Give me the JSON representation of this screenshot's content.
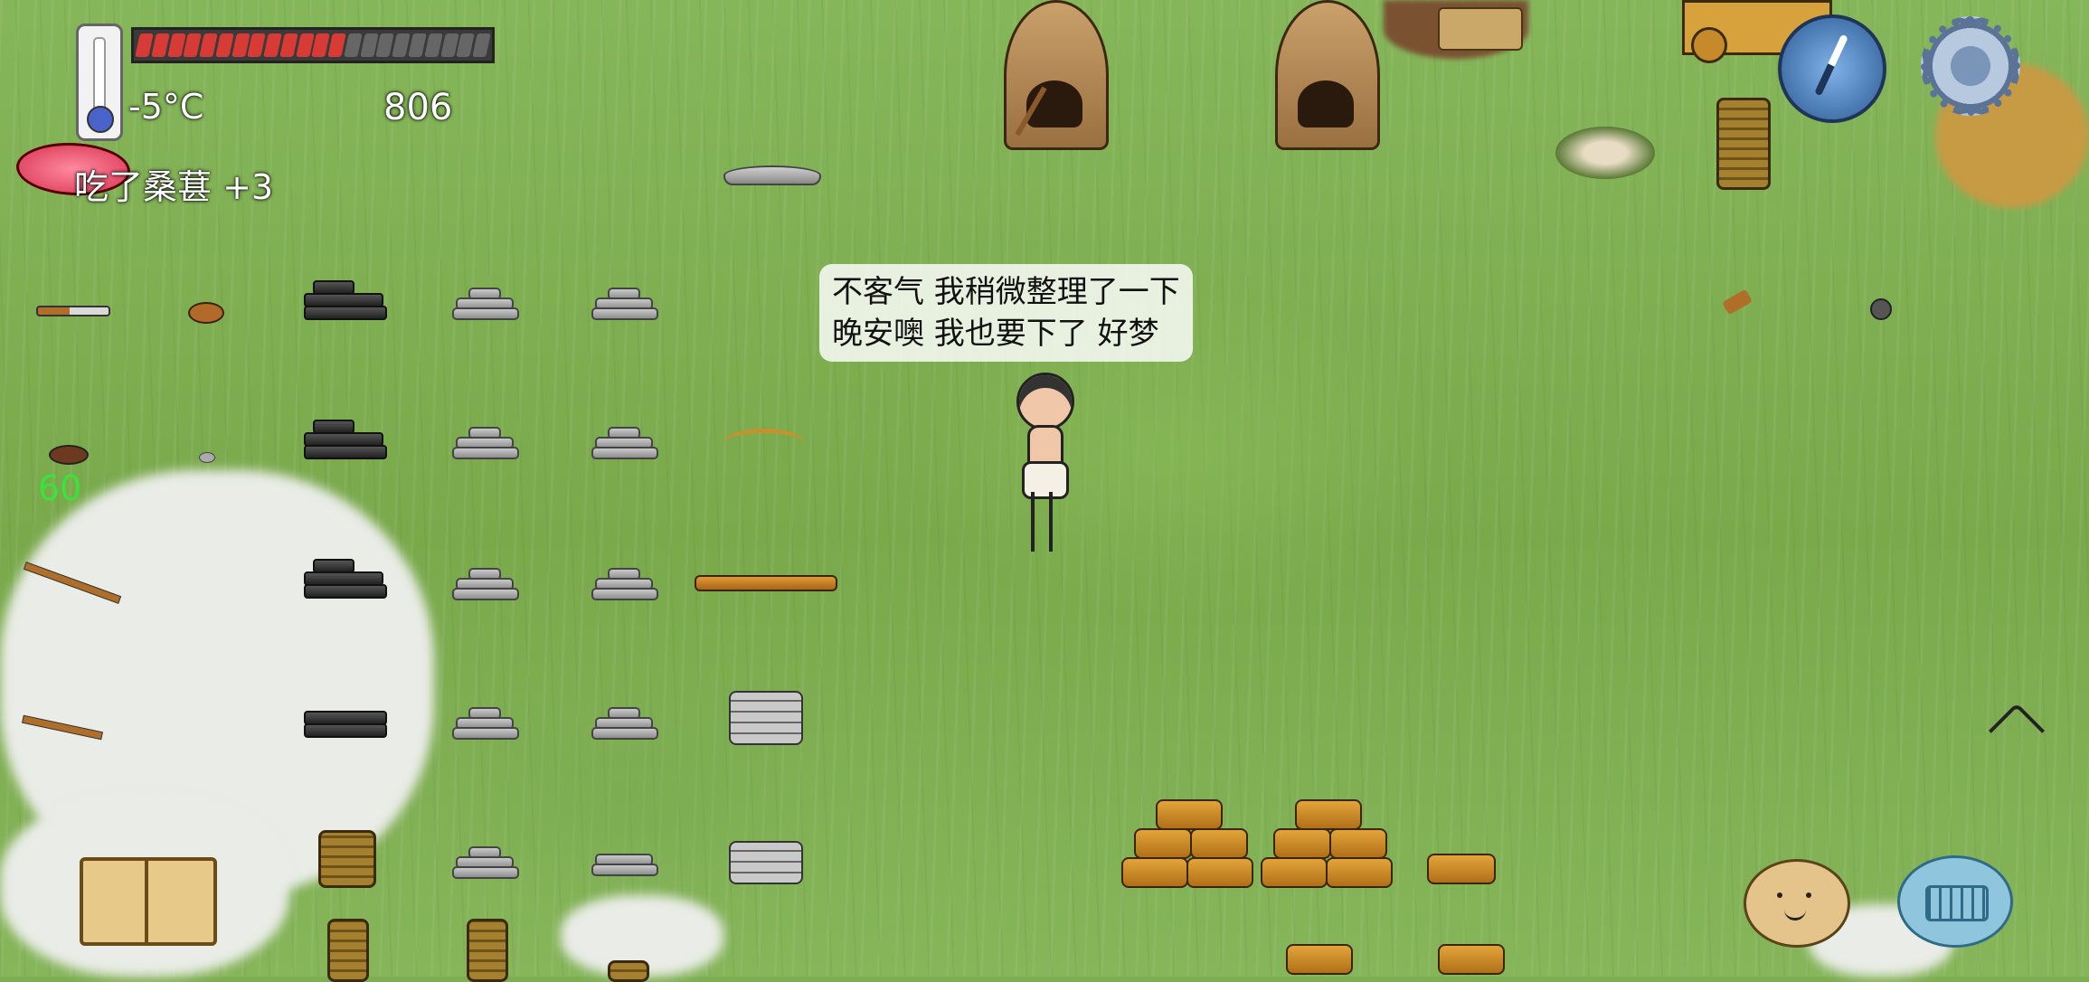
{
  "hud": {
    "temperature": "-5°C",
    "score": "806",
    "food_message": "吃了桑葚 +3",
    "food_bar_filled_segments": 13,
    "food_bar_total_segments": 22,
    "age_indicator": "60"
  },
  "speech_bubble": {
    "line1": "不客气 我稍微整理了一下",
    "line2": "晚安噢 我也要下了 好梦"
  },
  "icons": {
    "thermometer": "thermometer-icon",
    "compass": "compass-icon",
    "settings": "gear-icon",
    "tech_book": "book-icon",
    "emote": "face-icon",
    "chat": "keyboard-icon"
  },
  "colors": {
    "food_bar_fill": "#d83a35",
    "food_bar_empty": "#666666",
    "age_text": "#39e339",
    "grass": "#7fae52"
  }
}
